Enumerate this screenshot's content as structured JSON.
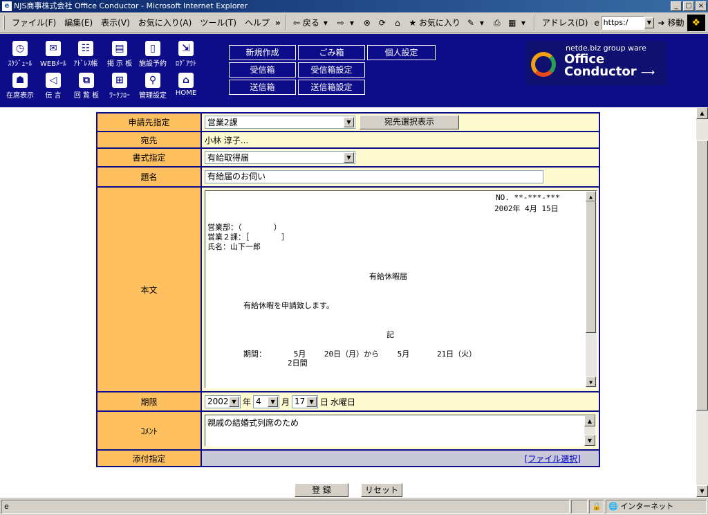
{
  "window": {
    "title": "NJS商事株式会社  Office Conductor - Microsoft Internet Explorer",
    "buttons": [
      "_",
      "▢",
      "×"
    ]
  },
  "menu": {
    "items": [
      "ファイル(F)",
      "編集(E)",
      "表示(V)",
      "お気に入り(A)",
      "ツール(T)",
      "ヘルプ"
    ],
    "more": "»"
  },
  "toolbar": {
    "back": "戻る",
    "forward_icon": "forward-arrow-icon",
    "favorites": "お気に入り",
    "address_label": "アドレス(D)",
    "address_value": "https:/",
    "go": "移動"
  },
  "nav": {
    "row1": [
      {
        "label": "ｽｹｼﾞｭｰﾙ",
        "icon": "clock-icon",
        "glyph": "◷"
      },
      {
        "label": "WEBﾒｰﾙ",
        "icon": "mail-icon",
        "glyph": "✉"
      },
      {
        "label": "ｱﾄﾞﾚｽ帳",
        "icon": "address-book-icon",
        "glyph": "☷"
      },
      {
        "label": "掲 示 板",
        "icon": "bulletin-icon",
        "glyph": "▤"
      },
      {
        "label": "施設予約",
        "icon": "facility-icon",
        "glyph": "▯"
      },
      {
        "label": "ﾛｸﾞｱｳﾄ",
        "icon": "logout-icon",
        "glyph": "⇲"
      }
    ],
    "row2": [
      {
        "label": "在席表示",
        "icon": "presence-icon",
        "glyph": "☗"
      },
      {
        "label": "伝  言",
        "icon": "message-icon",
        "glyph": "◁"
      },
      {
        "label": "回 覧 板",
        "icon": "circular-icon",
        "glyph": "⧉"
      },
      {
        "label": "ﾜｰｸﾌﾛｰ",
        "icon": "workflow-icon",
        "glyph": "⊞"
      },
      {
        "label": "管理設定",
        "icon": "admin-icon",
        "glyph": "⚲"
      },
      {
        "label": "HOME",
        "icon": "home-icon",
        "glyph": "⌂"
      }
    ],
    "buttons": [
      [
        "新規作成",
        "ごみ箱",
        "個人設定"
      ],
      [
        "受信箱",
        "受信箱設定"
      ],
      [
        "送信箱",
        "送信箱設定"
      ]
    ],
    "logo_tag": "netde.biz group ware",
    "logo_name1": "Office",
    "logo_name2": "Conductor"
  },
  "form": {
    "recipient_label": "申請先指定",
    "recipient_value": "営業2課",
    "recipient_button": "宛先選択表示",
    "to_label": "宛先",
    "to_value": "小林  淳子...",
    "format_label": "書式指定",
    "format_value": "有給取得届",
    "subject_label": "題名",
    "subject_value": "有給届のお伺い",
    "body_label": "本文",
    "body_lines": [
      "NO. **-***-***",
      "2002年 4月 15日",
      "営業部：（       ）",
      "営業２課：［       ］",
      "氏名：山下一郎",
      "有給休暇届",
      "有給休暇を申請致します。",
      "記",
      "期間：      5月    20日（月）から    5月      21日（火）",
      "2日間"
    ],
    "deadline_label": "期限",
    "deadline_year": "2002",
    "deadline_year_unit": "年",
    "deadline_month": "4",
    "deadline_month_unit": "月",
    "deadline_day": "17",
    "deadline_day_unit": "日",
    "deadline_weekday": "水曜日",
    "comment_label": "ｺﾒﾝﾄ",
    "comment_value": "親戚の結婚式列席のため",
    "attach_label": "添付指定",
    "attach_link": "[ファイル選択]"
  },
  "actions": {
    "submit": "登  録",
    "reset": "リセット"
  },
  "status": {
    "zone": "インターネット"
  }
}
